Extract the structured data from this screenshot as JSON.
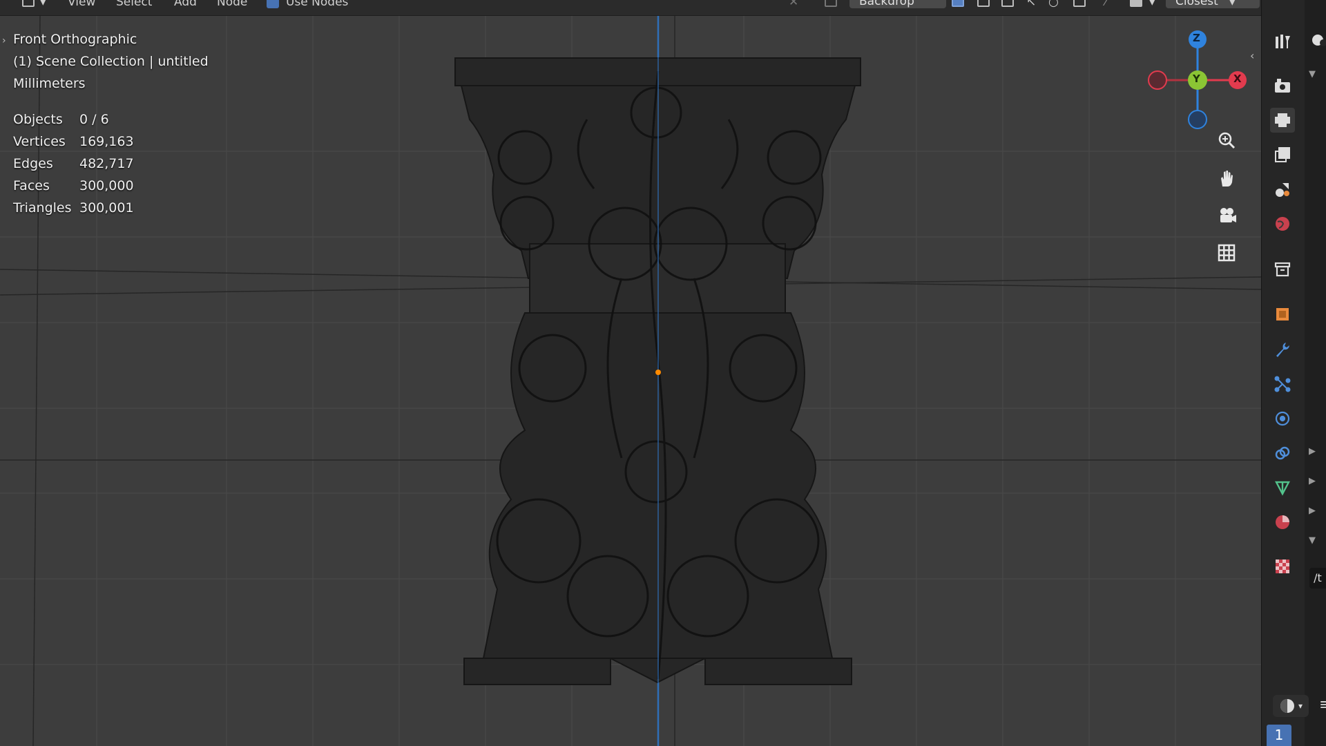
{
  "header": {
    "menu_view": "View",
    "menu_select": "Select",
    "menu_add": "Add",
    "menu_node": "Node",
    "use_nodes_label": "Use Nodes",
    "backdrop_label": "Backdrop",
    "snap_label": "Closest"
  },
  "viewport": {
    "view_name": "Front Orthographic",
    "collection": "(1) Scene Collection | untitled",
    "units": "Millimeters",
    "stats": [
      {
        "label": "Objects",
        "value": "0 / 6"
      },
      {
        "label": "Vertices",
        "value": "169,163"
      },
      {
        "label": "Edges",
        "value": "482,717"
      },
      {
        "label": "Faces",
        "value": "300,000"
      },
      {
        "label": "Triangles",
        "value": "300,001"
      }
    ]
  },
  "gizmo": {
    "axis_z": "Z",
    "axis_y": "Y",
    "axis_x": "X",
    "colors": {
      "x": "#e23b4e",
      "y": "#8bc534",
      "z": "#2f83de",
      "neg_x": "#b23340"
    }
  },
  "view_tools": [
    "zoom-icon",
    "pan-hand-icon",
    "camera-view-icon",
    "ortho-grid-icon"
  ],
  "properties_tabs": [
    "tool-icon",
    "render-icon",
    "output-icon",
    "view-layer-icon",
    "scene-icon",
    "world-icon",
    "collection-icon",
    "object-icon",
    "modifier-icon",
    "particles-icon",
    "physics-icon",
    "constraints-icon",
    "data-icon",
    "material-icon",
    "texture-icon"
  ],
  "current_frame": "1",
  "partial_text": "/t",
  "colors": {
    "viewport_bg": "#3d3d3d",
    "accent_blue": "#4772b3",
    "origin_dot": "#ff8a00"
  }
}
